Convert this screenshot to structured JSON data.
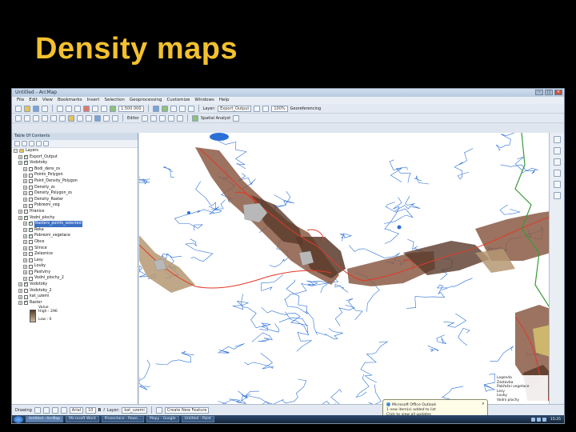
{
  "slide": {
    "title": "Density maps"
  },
  "app": {
    "title": "Untitled - ArcMap",
    "menu": [
      "File",
      "Edit",
      "View",
      "Bookmarks",
      "Insert",
      "Selection",
      "Geoprocessing",
      "Customize",
      "Windows",
      "Help"
    ],
    "toolbar1": {
      "scale": "1:500 000",
      "layer_label": "Layer:",
      "layer_value": "Export_Output",
      "zoom": "100%",
      "georef": "Georeferencing"
    },
    "toolbar2": {
      "editor": "Editor",
      "spatial_analyst": "Spatial Analyst",
      "drawing": "Drawing"
    },
    "toc": {
      "header": "Table Of Contents",
      "layers_root": "Layers",
      "items": [
        {
          "label": "Export_Output",
          "checked": true,
          "indent": 1
        },
        {
          "label": "Vodotoky",
          "checked": true,
          "indent": 1
        },
        {
          "label": "Bodi_dens_zs",
          "checked": false,
          "indent": 2
        },
        {
          "label": "Points_Polygon",
          "checked": false,
          "indent": 2
        },
        {
          "label": "Point_Density_Polygon",
          "checked": false,
          "indent": 2
        },
        {
          "label": "Density_zs",
          "checked": false,
          "indent": 2
        },
        {
          "label": "Density_Polygon_zs",
          "checked": false,
          "indent": 2
        },
        {
          "label": "Density_Raster",
          "checked": false,
          "indent": 2
        },
        {
          "label": "Pobrezni_veg",
          "checked": false,
          "indent": 2
        },
        {
          "label": "Hranice",
          "checked": false,
          "indent": 1
        },
        {
          "label": "Vodni_plochy",
          "checked": true,
          "indent": 1
        },
        {
          "label": "Rasters_points_selected",
          "checked": true,
          "indent": 2,
          "selected": true
        },
        {
          "label": "Reka",
          "checked": true,
          "indent": 2
        },
        {
          "label": "Pobrezni_vegetace",
          "checked": true,
          "indent": 2
        },
        {
          "label": "Obce",
          "checked": false,
          "indent": 2
        },
        {
          "label": "Silnice",
          "checked": false,
          "indent": 2
        },
        {
          "label": "Zeleznice",
          "checked": false,
          "indent": 2
        },
        {
          "label": "Lesy",
          "checked": false,
          "indent": 2
        },
        {
          "label": "Louky",
          "checked": false,
          "indent": 2
        },
        {
          "label": "Pastviny",
          "checked": false,
          "indent": 2
        },
        {
          "label": "Vodni_plochy_2",
          "checked": false,
          "indent": 2
        },
        {
          "label": "Vodotoky",
          "checked": true,
          "indent": 1
        },
        {
          "label": "Vodotoky_2",
          "checked": false,
          "indent": 1
        },
        {
          "label": "kat_uzemi",
          "checked": false,
          "indent": 1
        },
        {
          "label": "Raster",
          "checked": true,
          "indent": 1
        }
      ],
      "legend_value_label": "Value",
      "legend_high": "High : 296",
      "legend_low": "Low : 0"
    },
    "statusbar": {
      "drawing": "Drawing",
      "font": "Arial",
      "size": "10",
      "layer": "Layer:",
      "layer_value": "kat_uzemi",
      "task": "Create New Feature"
    },
    "balloon": {
      "title": "Microsoft Office Outlook",
      "line1": "1 new item(s) added to list",
      "line2": "Click to view all updates"
    },
    "side_legend": [
      "Legenda",
      "Zástavba",
      "Pobřežní vegetace",
      "Lesy",
      "Louky",
      "Vodní plochy"
    ],
    "taskbar": {
      "tasks": [
        "Untitled - ArcMap",
        "Microsoft Word",
        "Prezentace - Powe...",
        "Mapy - Google",
        "Untitled - Paint"
      ],
      "clock": "15:25"
    }
  },
  "colors": {
    "title": "#f2c12e",
    "rivers": "#2a6fd6",
    "density_dark": "#5a3a2a",
    "density_mid": "#8a5a44",
    "density_light": "#b59873",
    "boundary": "#e03a2a",
    "border_green": "#3a9a3a"
  }
}
